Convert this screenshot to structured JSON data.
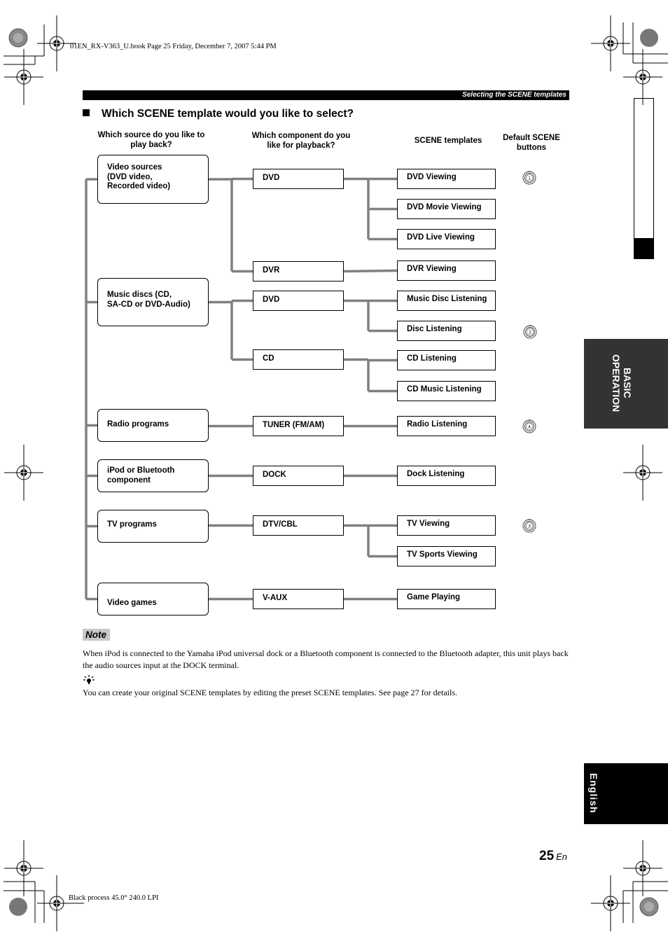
{
  "print_marks": {
    "book_header": "01EN_RX-V363_U.book  Page 25  Friday, December 7, 2007  5:44 PM",
    "footer_process": "Black process 45.0° 240.0 LPI"
  },
  "running_header": "Selecting the SCENE templates",
  "section_title": "Which SCENE template would you like to select?",
  "column_headers": {
    "source": "Which source do you like to play back?",
    "component": "Which component do you like for playback?",
    "templates": "SCENE templates",
    "buttons": "Default SCENE buttons"
  },
  "sources": [
    {
      "label": "Video sources\n(DVD video,\nRecorded video)"
    },
    {
      "label": "Music discs (CD,\nSA-CD or DVD-Audio)"
    },
    {
      "label": "Radio programs"
    },
    {
      "label": "iPod or Bluetooth\ncomponent"
    },
    {
      "label": "TV programs"
    },
    {
      "label": "Video games"
    }
  ],
  "components": [
    {
      "label": "DVD",
      "source": 0
    },
    {
      "label": "DVR",
      "source": 0
    },
    {
      "label": "DVD",
      "source": 1
    },
    {
      "label": "CD",
      "source": 1
    },
    {
      "label": "TUNER (FM/AM)",
      "source": 2
    },
    {
      "label": "DOCK",
      "source": 3
    },
    {
      "label": "DTV/CBL",
      "source": 4
    },
    {
      "label": "V-AUX",
      "source": 5
    }
  ],
  "templates": [
    {
      "label": "DVD Viewing",
      "component": 0
    },
    {
      "label": "DVD Movie Viewing",
      "component": 0
    },
    {
      "label": "DVD Live Viewing",
      "component": 0
    },
    {
      "label": "DVR Viewing",
      "component": 1
    },
    {
      "label": "Music Disc Listening",
      "component": 2
    },
    {
      "label": "Disc Listening",
      "component": 2
    },
    {
      "label": "CD Listening",
      "component": 3
    },
    {
      "label": "CD Music Listening",
      "component": 3
    },
    {
      "label": "Radio Listening",
      "component": 4
    },
    {
      "label": "Dock Listening",
      "component": 5
    },
    {
      "label": "TV Viewing",
      "component": 6
    },
    {
      "label": "TV Sports Viewing",
      "component": 6
    },
    {
      "label": "Game Playing",
      "component": 7
    }
  ],
  "scene_buttons": [
    {
      "number": "1",
      "icon": "scene-button-1-icon"
    },
    {
      "number": "2",
      "icon": "scene-button-2-icon"
    },
    {
      "number": "4",
      "icon": "scene-button-4-icon"
    },
    {
      "number": "3",
      "icon": "scene-button-3-icon"
    }
  ],
  "note": {
    "label": "Note",
    "text": "When iPod is connected to the Yamaha iPod universal dock or a Bluetooth component is connected to the Bluetooth adapter, this unit plays back the audio sources input at the DOCK terminal."
  },
  "tip": {
    "icon": "lightbulb-tip-icon",
    "text": "You can create your original SCENE templates by editing the preset SCENE templates. See page 27 for details."
  },
  "side_tabs": {
    "section": "BASIC\nOPERATION",
    "language": "English"
  },
  "page_number": "25",
  "page_lang": "En"
}
